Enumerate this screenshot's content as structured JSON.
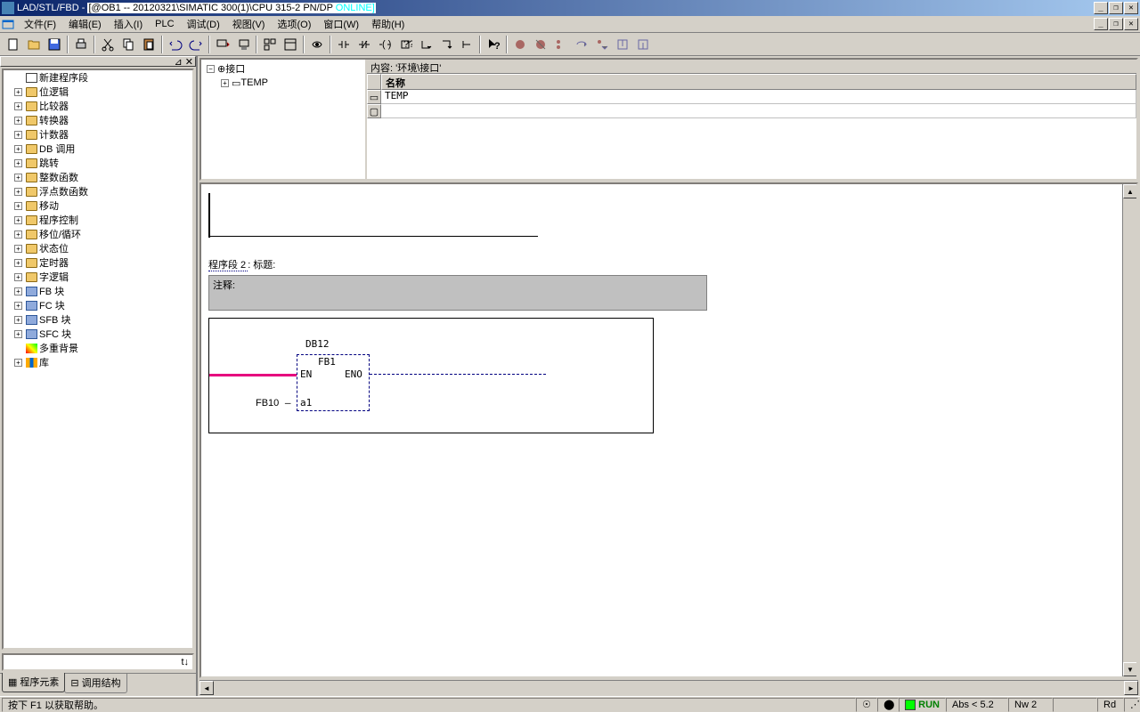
{
  "title": {
    "app": "LAD/STL/FBD",
    "doc": "[@OB1 -- 20120321\\SIMATIC 300(1)\\CPU 315-2 PN/DP",
    "online": " ONLINE]"
  },
  "menu": [
    "文件(F)",
    "编辑(E)",
    "插入(I)",
    "PLC",
    "调试(D)",
    "视图(V)",
    "选项(O)",
    "窗口(W)",
    "帮助(H)"
  ],
  "tree": [
    {
      "label": "新建程序段",
      "icon": "new",
      "exp": ""
    },
    {
      "label": "位逻辑",
      "icon": "folder",
      "exp": "+"
    },
    {
      "label": "比较器",
      "icon": "folder",
      "exp": "+"
    },
    {
      "label": "转换器",
      "icon": "folder",
      "exp": "+"
    },
    {
      "label": "计数器",
      "icon": "folder",
      "exp": "+"
    },
    {
      "label": "DB 调用",
      "icon": "folder",
      "exp": "+"
    },
    {
      "label": "跳转",
      "icon": "folder",
      "exp": "+"
    },
    {
      "label": "整数函数",
      "icon": "folder",
      "exp": "+"
    },
    {
      "label": "浮点数函数",
      "icon": "folder",
      "exp": "+"
    },
    {
      "label": "移动",
      "icon": "folder",
      "exp": "+"
    },
    {
      "label": "程序控制",
      "icon": "folder",
      "exp": "+"
    },
    {
      "label": "移位/循环",
      "icon": "folder",
      "exp": "+"
    },
    {
      "label": "状态位",
      "icon": "folder",
      "exp": "+"
    },
    {
      "label": "定时器",
      "icon": "folder",
      "exp": "+"
    },
    {
      "label": "字逻辑",
      "icon": "folder",
      "exp": "+"
    },
    {
      "label": "FB 块",
      "icon": "block",
      "exp": "+"
    },
    {
      "label": "FC 块",
      "icon": "block",
      "exp": "+"
    },
    {
      "label": "SFB 块",
      "icon": "block",
      "exp": "+"
    },
    {
      "label": "SFC 块",
      "icon": "block",
      "exp": "+"
    },
    {
      "label": "多重背景",
      "icon": "multi",
      "exp": ""
    },
    {
      "label": "库",
      "icon": "lib",
      "exp": "+"
    }
  ],
  "sidebar_tabs": [
    "程序元素",
    "调用结构"
  ],
  "interface": {
    "root": "接口",
    "child": "TEMP",
    "title": "内容:   '环境\\接口'",
    "header": "名称",
    "row0": "TEMP"
  },
  "network": {
    "label": "程序段 2",
    "title_sep": ": 标题:",
    "comment_label": "注释:",
    "fb_db": "DB12",
    "fb_name": "FB1",
    "fb_en": "EN",
    "fb_eno": "ENO",
    "fb_a1": "a1",
    "fb_input": "FB10"
  },
  "status": {
    "help": "按下 F1 以获取帮助。",
    "run": "RUN",
    "abs": "Abs < 5.2",
    "nw": "Nw 2",
    "mode": "Rd"
  }
}
